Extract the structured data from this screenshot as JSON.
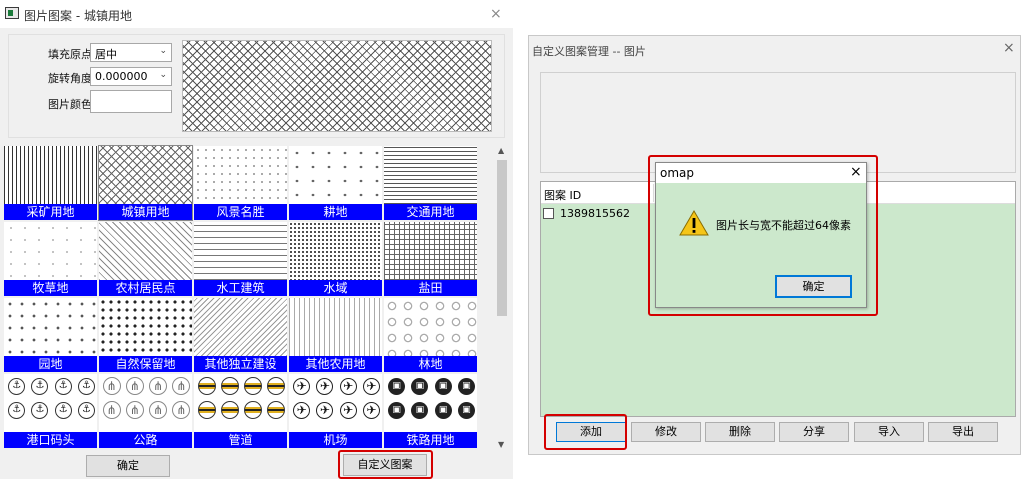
{
  "left_dialog": {
    "title": "图片图案 - 城镇用地",
    "close_glyph": "×",
    "fill_origin_label": "填充原点",
    "fill_origin_value": "居中",
    "rotation_label": "旋转角度",
    "rotation_value": "0.000000",
    "image_color_label": "图片颜色",
    "ok_label": "确定",
    "custom_pattern_label": "自定义图案"
  },
  "patterns": [
    "采矿用地",
    "城镇用地",
    "风景名胜",
    "耕地",
    "交通用地",
    "牧草地",
    "农村居民点",
    "水工建筑",
    "水域",
    "盐田",
    "园地",
    "自然保留地",
    "其他独立建设",
    "其他农用地",
    "林地",
    "港口码头",
    "公路",
    "管道",
    "机场",
    "铁路用地"
  ],
  "right_dialog": {
    "title": "自定义图案管理 -- 图片",
    "close_glyph": "×",
    "column_id": "图案 ID",
    "row_id": "1389815562",
    "buttons": {
      "add": "添加",
      "edit": "修改",
      "delete": "删除",
      "share": "分享",
      "import": "导入",
      "export": "导出"
    }
  },
  "message_box": {
    "title": "omap",
    "close_glyph": "×",
    "message": "图片长与宽不能超过64像素",
    "ok_label": "确定",
    "icon": "warning-icon"
  },
  "colors": {
    "caption_blue": "#0000ff",
    "highlight_red": "#d40000",
    "list_green": "#cce8cc",
    "focus_blue": "#0078d7"
  }
}
